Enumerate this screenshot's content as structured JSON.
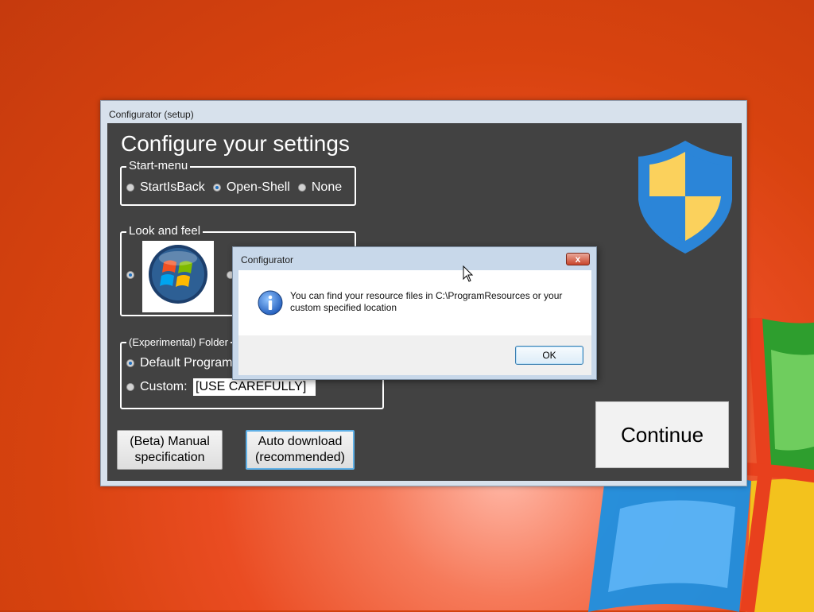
{
  "main_window": {
    "title": "Configurator (setup)",
    "heading": "Configure your settings"
  },
  "start_menu": {
    "legend": "Start-menu",
    "options": [
      "StartIsBack",
      "Open-Shell",
      "None"
    ],
    "selected": "Open-Shell"
  },
  "look_and_feel": {
    "legend": "Look and feel",
    "selected_logo": "windows-vista-logo"
  },
  "folder": {
    "legend": "(Experimental) Folder",
    "default_label": "Default Program",
    "custom_label": "Custom:",
    "custom_value": "[USE CAREFULLY]",
    "selected": "default"
  },
  "buttons": {
    "manual": "(Beta) Manual specification",
    "auto": "Auto download (recommended)",
    "continue": "Continue"
  },
  "dialog": {
    "title": "Configurator",
    "close": "x",
    "message": "You can find your resource files in C:\\ProgramResources or your custom specified location",
    "ok": "OK"
  },
  "colors": {
    "client_bg": "#424242",
    "shield_blue": "#2b85d8",
    "shield_yellow": "#fbd15c",
    "desktop_orange": "#d8430f"
  }
}
